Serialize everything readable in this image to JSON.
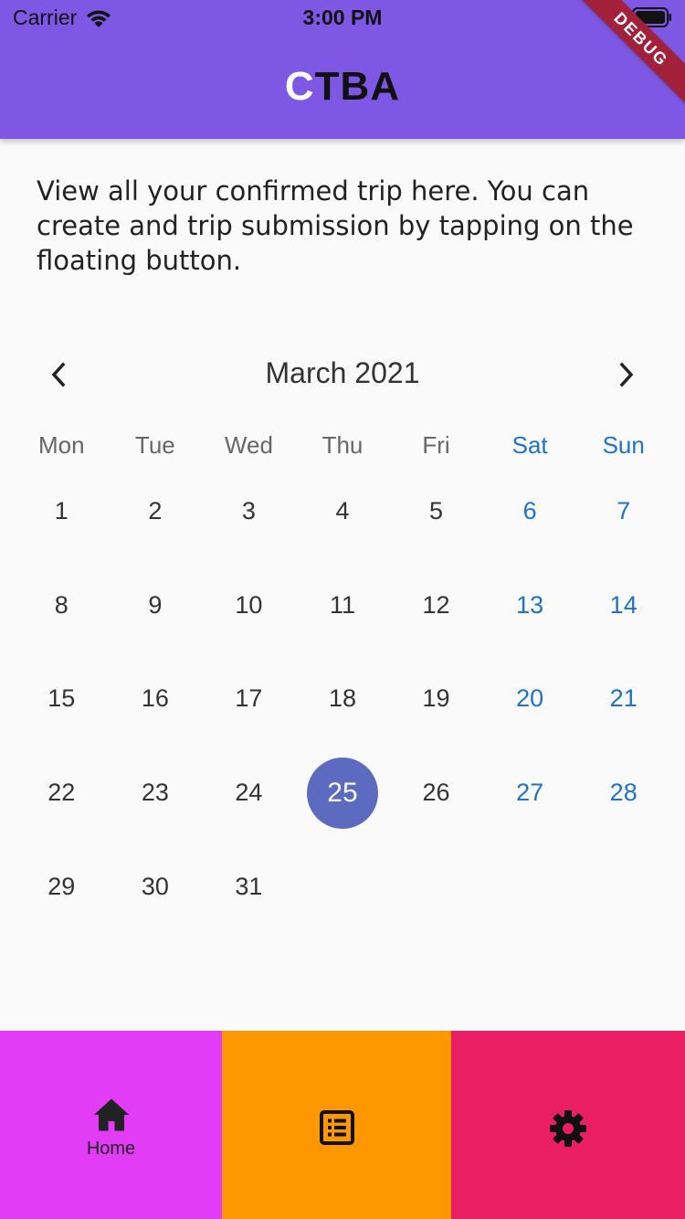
{
  "status_bar": {
    "carrier": "Carrier",
    "time": "3:00 PM"
  },
  "app_bar": {
    "title_first": "C",
    "title_rest": "TBA",
    "debug_banner": "DEBUG",
    "background": "#7e57e4"
  },
  "intro": {
    "text": "View all your confirmed trip here. You can create and trip submission by tapping on the floating button."
  },
  "calendar": {
    "month_title": "March 2021",
    "weekdays": [
      "Mon",
      "Tue",
      "Wed",
      "Thu",
      "Fri",
      "Sat",
      "Sun"
    ],
    "days": [
      [
        "1",
        "2",
        "3",
        "4",
        "5",
        "6",
        "7"
      ],
      [
        "8",
        "9",
        "10",
        "11",
        "12",
        "13",
        "14"
      ],
      [
        "15",
        "16",
        "17",
        "18",
        "19",
        "20",
        "21"
      ],
      [
        "22",
        "23",
        "24",
        "25",
        "26",
        "27",
        "28"
      ],
      [
        "29",
        "30",
        "31",
        "",
        "",
        "",
        ""
      ]
    ],
    "selected_day": "25",
    "selected_color": "#5c6bc0",
    "weekend_color": "#1e73c8"
  },
  "bottom_nav": {
    "home_label": "Home",
    "home_color": "#e23cf6",
    "list_color": "#ff9800",
    "settings_color": "#e91e63"
  },
  "icons": {
    "prev": "chevron-left-icon",
    "next": "chevron-right-icon",
    "home": "home-icon",
    "list": "list-alt-icon",
    "settings": "gear-icon"
  }
}
